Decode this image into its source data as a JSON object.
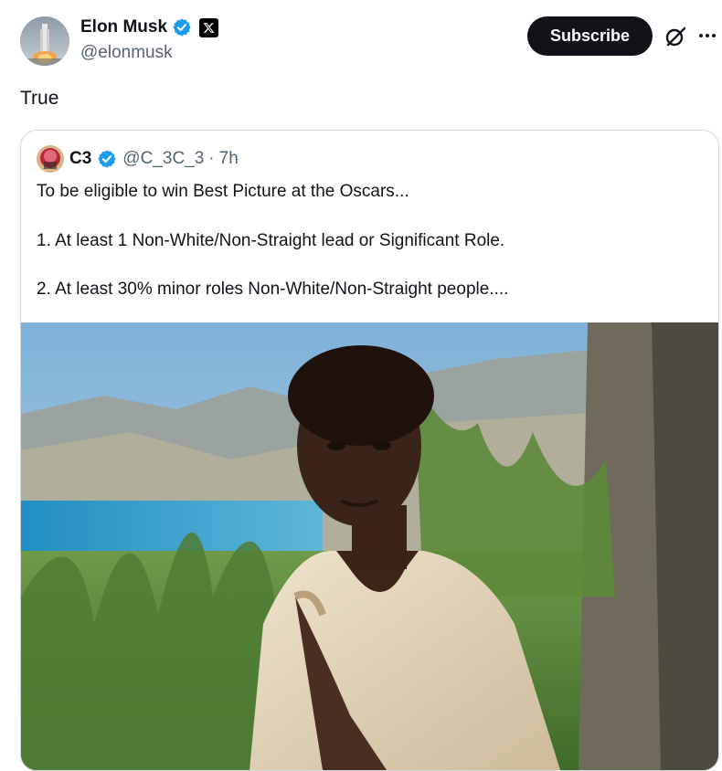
{
  "post": {
    "author_name": "Elon Musk",
    "author_handle": "@elonmusk",
    "subscribe_label": "Subscribe",
    "text": "True"
  },
  "quote": {
    "author_name": "C3",
    "author_handle": "@C_3C_3",
    "separator": "·",
    "time": "7h",
    "lines": [
      "To be eligible to win Best Picture at the Oscars...",
      "1. At least 1 Non-White/Non-Straight lead or Significant Role.",
      "2. At least 30% minor roles Non-White/Non-Straight people...."
    ]
  },
  "icons": {
    "verified": "verified-badge-icon",
    "x_affiliation": "x-logo-icon",
    "grok": "grok-icon",
    "more": "more-icon"
  },
  "colors": {
    "verified_blue": "#1d9bf0",
    "subscribe_bg": "#0f1419",
    "secondary_text": "#536471",
    "border": "#cfd9de"
  }
}
